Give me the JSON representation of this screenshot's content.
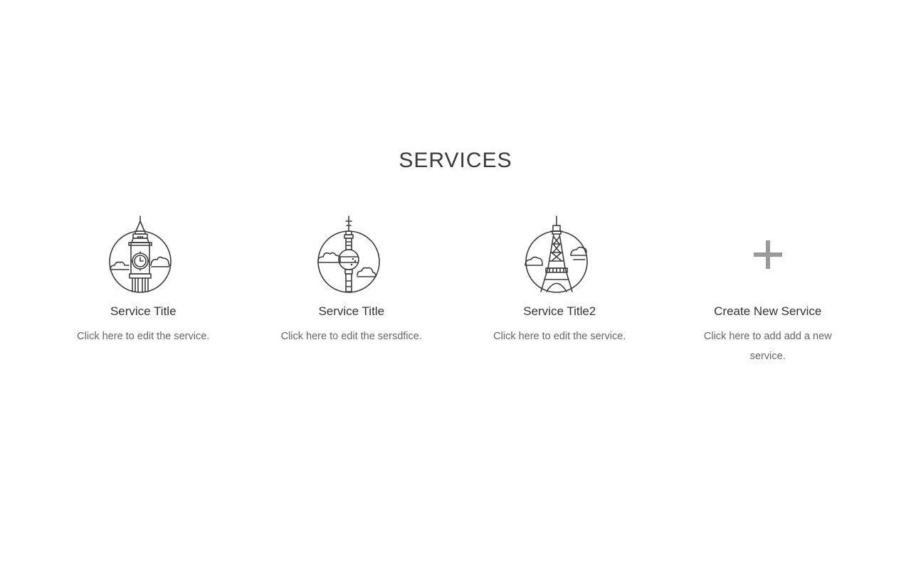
{
  "section": {
    "title": "SERVICES"
  },
  "services": [
    {
      "icon": "big-ben-icon",
      "title": "Service Title",
      "description": "Click here to edit the service."
    },
    {
      "icon": "tv-tower-icon",
      "title": "Service Title",
      "description": "Click here to edit the sersdfice."
    },
    {
      "icon": "eiffel-tower-icon",
      "title": "Service Title2",
      "description": "Click here to edit the service."
    },
    {
      "icon": "plus-icon",
      "title": "Create New Service",
      "description": "Click here to add add a new service."
    }
  ],
  "colors": {
    "icon_stroke": "#3d3d3d",
    "plus": "#9a9a9a",
    "title": "#333333",
    "text": "#666666"
  }
}
